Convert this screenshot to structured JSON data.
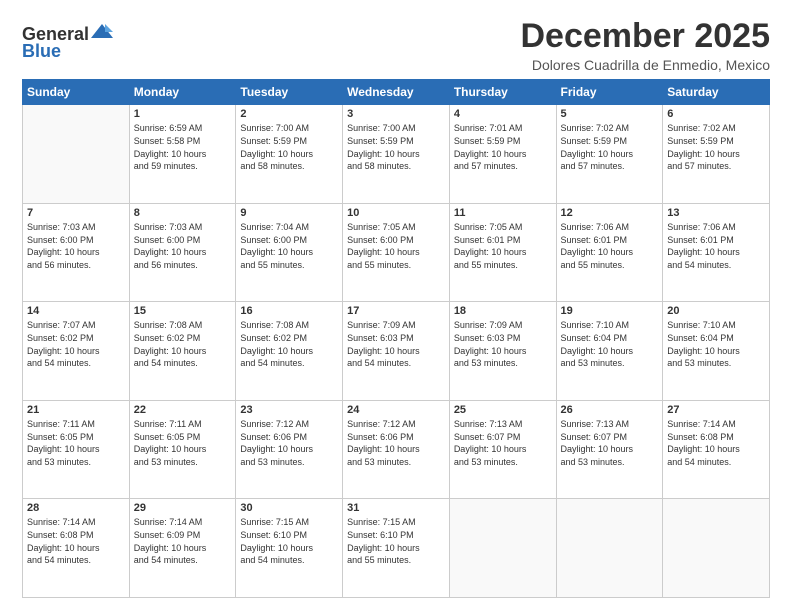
{
  "logo": {
    "general": "General",
    "blue": "Blue"
  },
  "header": {
    "month": "December 2025",
    "location": "Dolores Cuadrilla de Enmedio, Mexico"
  },
  "weekdays": [
    "Sunday",
    "Monday",
    "Tuesday",
    "Wednesday",
    "Thursday",
    "Friday",
    "Saturday"
  ],
  "weeks": [
    [
      {
        "day": "",
        "info": ""
      },
      {
        "day": "1",
        "info": "Sunrise: 6:59 AM\nSunset: 5:58 PM\nDaylight: 10 hours\nand 59 minutes."
      },
      {
        "day": "2",
        "info": "Sunrise: 7:00 AM\nSunset: 5:59 PM\nDaylight: 10 hours\nand 58 minutes."
      },
      {
        "day": "3",
        "info": "Sunrise: 7:00 AM\nSunset: 5:59 PM\nDaylight: 10 hours\nand 58 minutes."
      },
      {
        "day": "4",
        "info": "Sunrise: 7:01 AM\nSunset: 5:59 PM\nDaylight: 10 hours\nand 57 minutes."
      },
      {
        "day": "5",
        "info": "Sunrise: 7:02 AM\nSunset: 5:59 PM\nDaylight: 10 hours\nand 57 minutes."
      },
      {
        "day": "6",
        "info": "Sunrise: 7:02 AM\nSunset: 5:59 PM\nDaylight: 10 hours\nand 57 minutes."
      }
    ],
    [
      {
        "day": "7",
        "info": "Sunrise: 7:03 AM\nSunset: 6:00 PM\nDaylight: 10 hours\nand 56 minutes."
      },
      {
        "day": "8",
        "info": "Sunrise: 7:03 AM\nSunset: 6:00 PM\nDaylight: 10 hours\nand 56 minutes."
      },
      {
        "day": "9",
        "info": "Sunrise: 7:04 AM\nSunset: 6:00 PM\nDaylight: 10 hours\nand 55 minutes."
      },
      {
        "day": "10",
        "info": "Sunrise: 7:05 AM\nSunset: 6:00 PM\nDaylight: 10 hours\nand 55 minutes."
      },
      {
        "day": "11",
        "info": "Sunrise: 7:05 AM\nSunset: 6:01 PM\nDaylight: 10 hours\nand 55 minutes."
      },
      {
        "day": "12",
        "info": "Sunrise: 7:06 AM\nSunset: 6:01 PM\nDaylight: 10 hours\nand 55 minutes."
      },
      {
        "day": "13",
        "info": "Sunrise: 7:06 AM\nSunset: 6:01 PM\nDaylight: 10 hours\nand 54 minutes."
      }
    ],
    [
      {
        "day": "14",
        "info": "Sunrise: 7:07 AM\nSunset: 6:02 PM\nDaylight: 10 hours\nand 54 minutes."
      },
      {
        "day": "15",
        "info": "Sunrise: 7:08 AM\nSunset: 6:02 PM\nDaylight: 10 hours\nand 54 minutes."
      },
      {
        "day": "16",
        "info": "Sunrise: 7:08 AM\nSunset: 6:02 PM\nDaylight: 10 hours\nand 54 minutes."
      },
      {
        "day": "17",
        "info": "Sunrise: 7:09 AM\nSunset: 6:03 PM\nDaylight: 10 hours\nand 54 minutes."
      },
      {
        "day": "18",
        "info": "Sunrise: 7:09 AM\nSunset: 6:03 PM\nDaylight: 10 hours\nand 53 minutes."
      },
      {
        "day": "19",
        "info": "Sunrise: 7:10 AM\nSunset: 6:04 PM\nDaylight: 10 hours\nand 53 minutes."
      },
      {
        "day": "20",
        "info": "Sunrise: 7:10 AM\nSunset: 6:04 PM\nDaylight: 10 hours\nand 53 minutes."
      }
    ],
    [
      {
        "day": "21",
        "info": "Sunrise: 7:11 AM\nSunset: 6:05 PM\nDaylight: 10 hours\nand 53 minutes."
      },
      {
        "day": "22",
        "info": "Sunrise: 7:11 AM\nSunset: 6:05 PM\nDaylight: 10 hours\nand 53 minutes."
      },
      {
        "day": "23",
        "info": "Sunrise: 7:12 AM\nSunset: 6:06 PM\nDaylight: 10 hours\nand 53 minutes."
      },
      {
        "day": "24",
        "info": "Sunrise: 7:12 AM\nSunset: 6:06 PM\nDaylight: 10 hours\nand 53 minutes."
      },
      {
        "day": "25",
        "info": "Sunrise: 7:13 AM\nSunset: 6:07 PM\nDaylight: 10 hours\nand 53 minutes."
      },
      {
        "day": "26",
        "info": "Sunrise: 7:13 AM\nSunset: 6:07 PM\nDaylight: 10 hours\nand 53 minutes."
      },
      {
        "day": "27",
        "info": "Sunrise: 7:14 AM\nSunset: 6:08 PM\nDaylight: 10 hours\nand 54 minutes."
      }
    ],
    [
      {
        "day": "28",
        "info": "Sunrise: 7:14 AM\nSunset: 6:08 PM\nDaylight: 10 hours\nand 54 minutes."
      },
      {
        "day": "29",
        "info": "Sunrise: 7:14 AM\nSunset: 6:09 PM\nDaylight: 10 hours\nand 54 minutes."
      },
      {
        "day": "30",
        "info": "Sunrise: 7:15 AM\nSunset: 6:10 PM\nDaylight: 10 hours\nand 54 minutes."
      },
      {
        "day": "31",
        "info": "Sunrise: 7:15 AM\nSunset: 6:10 PM\nDaylight: 10 hours\nand 55 minutes."
      },
      {
        "day": "",
        "info": ""
      },
      {
        "day": "",
        "info": ""
      },
      {
        "day": "",
        "info": ""
      }
    ]
  ]
}
